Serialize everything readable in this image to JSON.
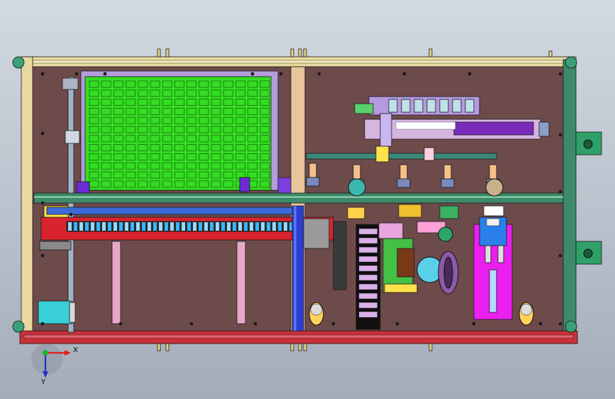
{
  "viewport": {
    "background_top": "#d3d9e1",
    "background_bottom": "#a3acb8"
  },
  "model": {
    "frame_color": "#e8d9a0",
    "base_plate_color": "#6e4b4b",
    "rail_color": "#3d8a6a",
    "bottom_beam_color": "#c8303a",
    "tray_outer_color": "#b39ddb",
    "tray_grid_color": "#33dd22",
    "conveyor_color": "#2a3fd0",
    "inspection_module_color": "#ea1ff0"
  },
  "triad": {
    "x_label": "X",
    "y_label": "Y",
    "x_color": "#e02020",
    "y_color": "#2030d0",
    "origin_color": "#20b030"
  }
}
